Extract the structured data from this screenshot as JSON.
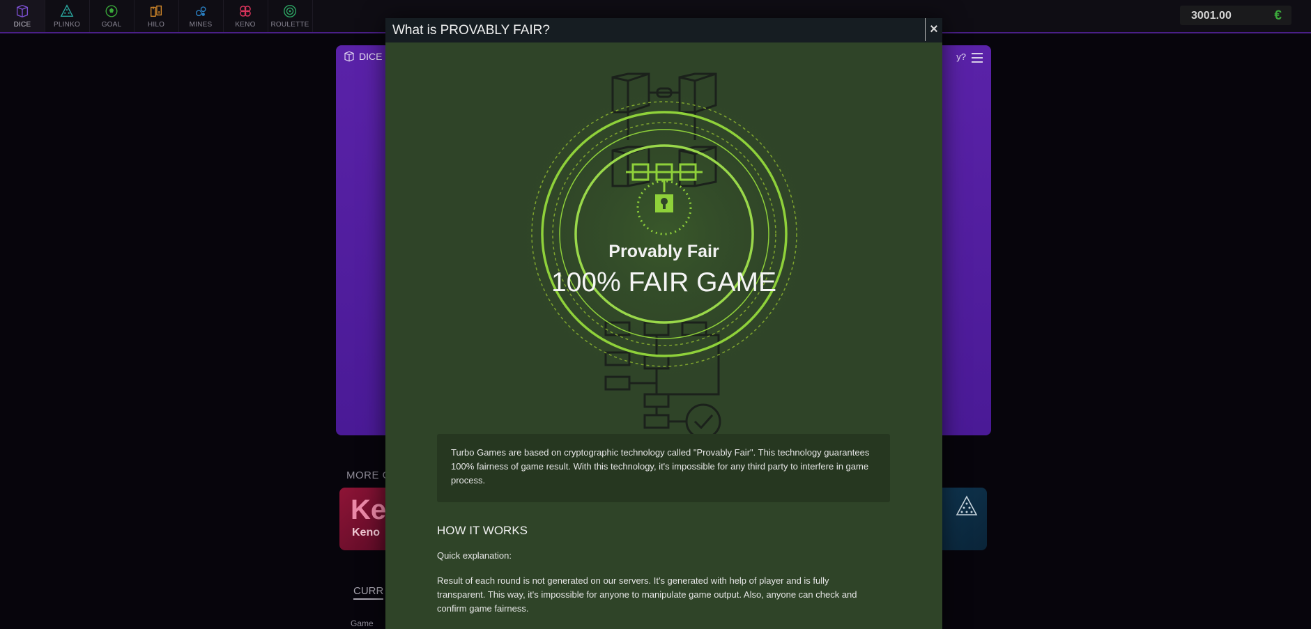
{
  "nav": {
    "items": [
      {
        "label": "DICE",
        "icon": "dice-icon",
        "active": true
      },
      {
        "label": "PLINKO",
        "icon": "plinko-icon"
      },
      {
        "label": "GOAL",
        "icon": "goal-icon"
      },
      {
        "label": "HILO",
        "icon": "hilo-icon"
      },
      {
        "label": "MINES",
        "icon": "mines-icon"
      },
      {
        "label": "KENO",
        "icon": "keno-icon"
      },
      {
        "label": "ROULETTE",
        "icon": "roulette-icon"
      }
    ],
    "balance": "3001.00",
    "currency": "€"
  },
  "game": {
    "tab_label": "DICE",
    "help_text": "y?",
    "more_label": "MORE G",
    "card_left_big": "Ke",
    "card_left_small": "Keno",
    "current_label": "CURR",
    "col_game": "Game"
  },
  "modal": {
    "title": "What is PROVABLY FAIR?",
    "close_symbol": "×",
    "hero_title": "Provably Fair",
    "hero_subtitle": "100% FAIR GAME",
    "intro": "Turbo Games are based on cryptographic technology called \"Provably Fair\". This technology guarantees 100% fairness of game result. With this technology, it's impossible for any third party to interfere in game process.",
    "how_title": "HOW IT WORKS",
    "quick": "Quick explanation:",
    "result": "Result of each round is not generated on our servers. It's generated with help of player and is fully transparent. This way, it's impossible for anyone to manipulate game output. Also, anyone can check and confirm game fairness."
  },
  "colors": {
    "accent_purple": "#5a22a8",
    "modal_green": "#2f4428",
    "lime": "#8fd13a",
    "currency_green": "#3ba83b"
  }
}
